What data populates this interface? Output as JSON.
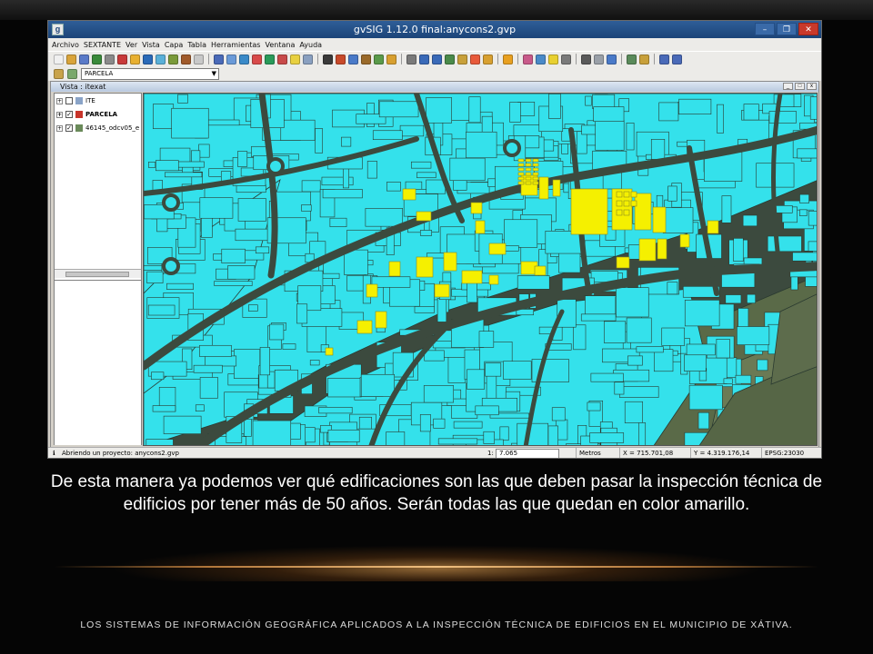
{
  "window": {
    "title": "gvSIG 1.12.0 final:anycons2.gvp",
    "controls": [
      "–",
      "❐",
      "✕"
    ]
  },
  "menu": [
    "Archivo",
    "SEXTANTE",
    "Ver",
    "Vista",
    "Capa",
    "Tabla",
    "Herramientas",
    "Ventana",
    "Ayuda"
  ],
  "toolbar": {
    "active_layer": "PARCELA"
  },
  "view": {
    "title": "Vista : itexat",
    "layers": [
      {
        "name": "ITE",
        "checked": false,
        "expanded": false
      },
      {
        "name": "PARCELA",
        "checked": true,
        "expanded": false
      },
      {
        "name": "46145_odcv05_e",
        "checked": true,
        "expanded": false
      }
    ]
  },
  "status": {
    "message": "Abriendo un proyecto: anycons2.gvp",
    "scale_prefix": "1:",
    "scale": "7.065",
    "units": "Metros",
    "x": "X = 715.701,08",
    "y": "Y = 4.319.176,14",
    "epsg": "EPSG:23030"
  },
  "colors": {
    "parcel_fill": "#34e1eb",
    "ite_highlight": "#f5f000",
    "road_dark": "#3c4a3e",
    "divider_gold": "#f0c080"
  },
  "caption": "De esta manera ya podemos ver qué edificaciones son las que deben pasar la inspección técnica de edificios por tener más de 50 años. Serán todas las que quedan en color amarillo.",
  "footer": "LOS SISTEMAS DE INFORMACIÓN GEOGRÁFICA APLICADOS A LA INSPECCIÓN TÉCNICA DE EDIFICIOS EN EL MUNICIPIO DE XÁTIVA."
}
